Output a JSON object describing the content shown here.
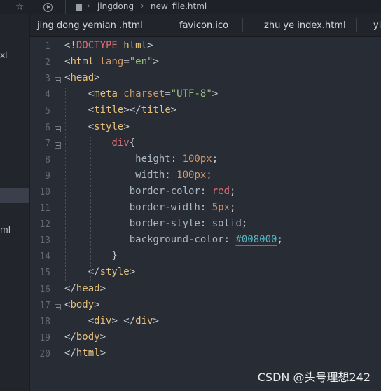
{
  "breadcrumb": {
    "folder": "jingdong",
    "file": "new_file.html"
  },
  "tabs": [
    {
      "label": "jing  dong yemian .html"
    },
    {
      "label": "favicon.ico"
    },
    {
      "label": "zhu ye index.html"
    },
    {
      "label": "yi"
    }
  ],
  "sidebar": {
    "items": [
      {
        "label": "xi"
      },
      {
        "label": "ml"
      }
    ]
  },
  "editor": {
    "line_numbers": [
      "1",
      "2",
      "3",
      "4",
      "5",
      "6",
      "7",
      "8",
      "9",
      "10",
      "11",
      "12",
      "13",
      "14",
      "15",
      "16",
      "17",
      "18",
      "19",
      "20"
    ],
    "lines": [
      {
        "tokens": [
          {
            "t": "<!",
            "c": "punc"
          },
          {
            "t": "DOCTYPE",
            "c": "kw"
          },
          {
            "t": " html",
            "c": "tag"
          },
          {
            "t": ">",
            "c": "punc"
          }
        ]
      },
      {
        "tokens": [
          {
            "t": "<",
            "c": "punc"
          },
          {
            "t": "html",
            "c": "tag"
          },
          {
            "t": " lang",
            "c": "attr"
          },
          {
            "t": "=",
            "c": "punc"
          },
          {
            "t": "\"en\"",
            "c": "str"
          },
          {
            "t": ">",
            "c": "punc"
          }
        ]
      },
      {
        "tokens": [
          {
            "t": "<",
            "c": "punc"
          },
          {
            "t": "head",
            "c": "tag"
          },
          {
            "t": ">",
            "c": "punc"
          }
        ]
      },
      {
        "tokens": [
          {
            "t": "    <",
            "c": "punc"
          },
          {
            "t": "meta",
            "c": "tag"
          },
          {
            "t": " charset",
            "c": "attr"
          },
          {
            "t": "=",
            "c": "punc"
          },
          {
            "t": "\"UTF-8\"",
            "c": "str"
          },
          {
            "t": ">",
            "c": "punc"
          }
        ]
      },
      {
        "tokens": [
          {
            "t": "    <",
            "c": "punc"
          },
          {
            "t": "title",
            "c": "tag"
          },
          {
            "t": "></",
            "c": "punc"
          },
          {
            "t": "title",
            "c": "tag"
          },
          {
            "t": ">",
            "c": "punc"
          }
        ]
      },
      {
        "tokens": [
          {
            "t": "    <",
            "c": "punc"
          },
          {
            "t": "style",
            "c": "tag"
          },
          {
            "t": ">",
            "c": "punc"
          }
        ]
      },
      {
        "tokens": [
          {
            "t": "        div",
            "c": "kw"
          },
          {
            "t": "{",
            "c": "punc"
          }
        ]
      },
      {
        "tokens": [
          {
            "t": "            height",
            "c": "prop"
          },
          {
            "t": ": ",
            "c": "punc"
          },
          {
            "t": "100px",
            "c": "num"
          },
          {
            "t": ";",
            "c": "punc"
          }
        ]
      },
      {
        "tokens": [
          {
            "t": "            width",
            "c": "prop"
          },
          {
            "t": ": ",
            "c": "punc"
          },
          {
            "t": "100px",
            "c": "num"
          },
          {
            "t": ";",
            "c": "punc"
          }
        ]
      },
      {
        "tokens": [
          {
            "t": "           border-color",
            "c": "prop"
          },
          {
            "t": ": ",
            "c": "punc"
          },
          {
            "t": "red",
            "c": "kw"
          },
          {
            "t": ";",
            "c": "punc"
          }
        ]
      },
      {
        "tokens": [
          {
            "t": "           border-width",
            "c": "prop"
          },
          {
            "t": ": ",
            "c": "punc"
          },
          {
            "t": "5px",
            "c": "num"
          },
          {
            "t": ";",
            "c": "punc"
          }
        ]
      },
      {
        "tokens": [
          {
            "t": "           border-style",
            "c": "prop"
          },
          {
            "t": ": ",
            "c": "punc"
          },
          {
            "t": "solid",
            "c": "prop"
          },
          {
            "t": ";",
            "c": "punc"
          }
        ]
      },
      {
        "tokens": [
          {
            "t": "           background-color",
            "c": "prop"
          },
          {
            "t": ": ",
            "c": "punc"
          },
          {
            "t": "#008000",
            "c": "hex"
          },
          {
            "t": ";",
            "c": "punc"
          }
        ]
      },
      {
        "tokens": [
          {
            "t": "        }",
            "c": "punc"
          }
        ]
      },
      {
        "tokens": [
          {
            "t": "    </",
            "c": "punc"
          },
          {
            "t": "style",
            "c": "tag"
          },
          {
            "t": ">",
            "c": "punc"
          }
        ]
      },
      {
        "tokens": [
          {
            "t": "</",
            "c": "punc"
          },
          {
            "t": "head",
            "c": "tag"
          },
          {
            "t": ">",
            "c": "punc"
          }
        ]
      },
      {
        "tokens": [
          {
            "t": "<",
            "c": "punc"
          },
          {
            "t": "body",
            "c": "tag"
          },
          {
            "t": ">",
            "c": "punc"
          }
        ]
      },
      {
        "tokens": [
          {
            "t": "    <",
            "c": "punc"
          },
          {
            "t": "div",
            "c": "tag"
          },
          {
            "t": "> </",
            "c": "punc"
          },
          {
            "t": "div",
            "c": "tag"
          },
          {
            "t": ">",
            "c": "punc"
          }
        ]
      },
      {
        "tokens": [
          {
            "t": "</",
            "c": "punc"
          },
          {
            "t": "body",
            "c": "tag"
          },
          {
            "t": ">",
            "c": "punc"
          }
        ]
      },
      {
        "tokens": [
          {
            "t": "</",
            "c": "punc"
          },
          {
            "t": "html",
            "c": "tag"
          },
          {
            "t": ">",
            "c": "punc"
          }
        ]
      }
    ]
  },
  "watermark": "CSDN @头号理想242"
}
